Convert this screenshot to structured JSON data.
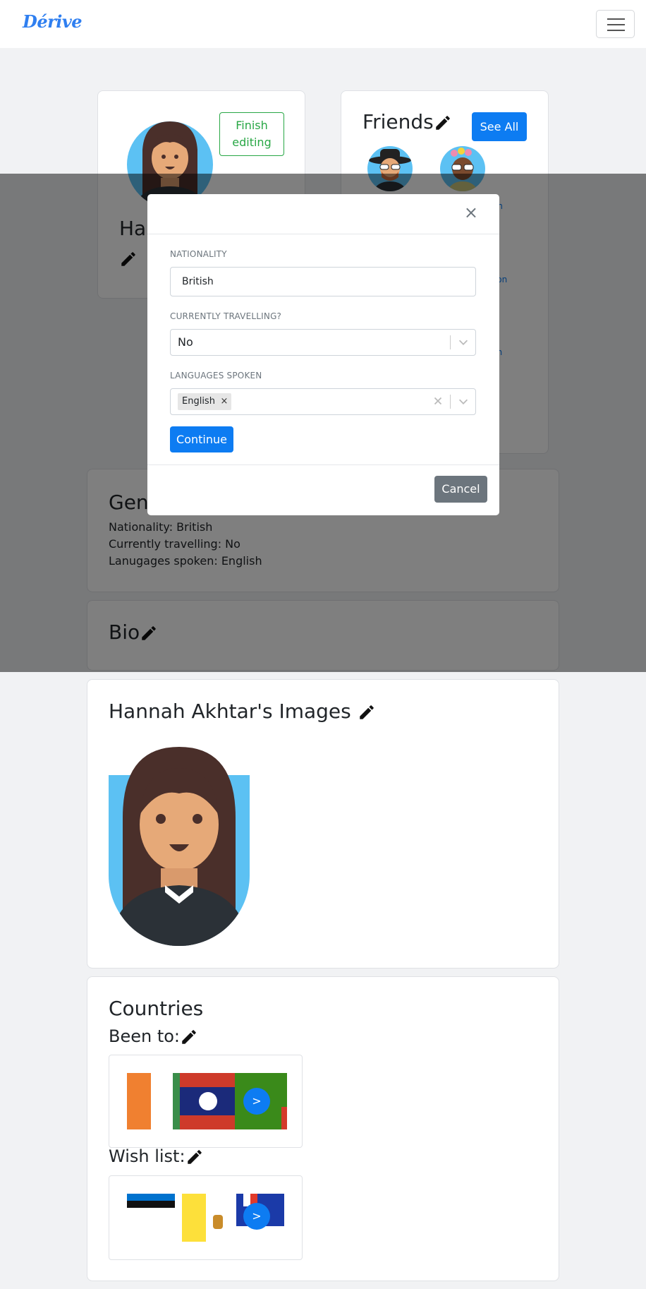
{
  "brand": "Dérive",
  "profile": {
    "edit_button": "Finish editing",
    "name_partial": "Ha"
  },
  "friends": {
    "title": "Friends",
    "see_all": "See All",
    "link_fragments": [
      "on",
      "son",
      "ch"
    ]
  },
  "general": {
    "title_partial": "Gene",
    "nationality_line": "Nationality: British",
    "travelling_line": "Currently travelling: No",
    "languages_line": "Lanugages spoken: English"
  },
  "bio": {
    "title": "Bio"
  },
  "images": {
    "title": "Hannah Akhtar's Images"
  },
  "countries": {
    "title": "Countries",
    "been_to": "Been to:",
    "wish_list": "Wish list:",
    "next_label": ">"
  },
  "modal": {
    "close": "×",
    "nationality_label": "NATIONALITY",
    "nationality_value": "British",
    "travelling_label": "CURRENTLY TRAVELLING?",
    "travelling_value": "No",
    "languages_label": "LANGUAGES SPOKEN",
    "language_tag": "English",
    "tag_remove": "×",
    "continue": "Continue",
    "cancel": "Cancel"
  },
  "colors": {
    "primary": "#0d7cf2",
    "success": "#28a745",
    "secondary": "#6c757d",
    "brand": "#2f7ff0"
  },
  "icons": [
    "hamburger-icon",
    "pencil-icon",
    "close-icon",
    "chevron-down-icon",
    "clear-icon"
  ]
}
